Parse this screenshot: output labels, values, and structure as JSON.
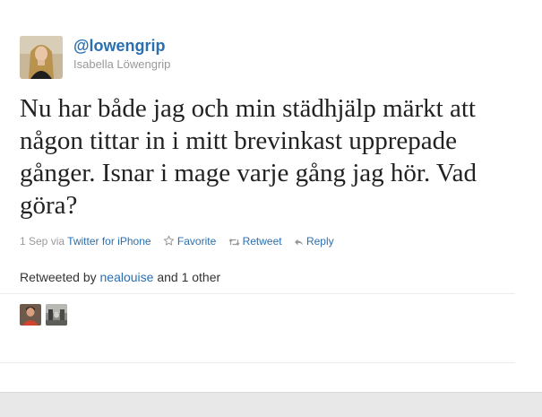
{
  "tweet": {
    "screen_name": "@lowengrip",
    "full_name": "Isabella Löwengrip",
    "text": "Nu har både jag och min städhjälp märkt att någon tittar in i mitt brevinkast upprepade gånger. Isnar i mage varje gång jag hör. Vad göra?",
    "date": "1 Sep",
    "via_label": "via",
    "source": "Twitter for iPhone",
    "actions": {
      "favorite": "Favorite",
      "retweet": "Retweet",
      "reply": "Reply"
    }
  },
  "retweeted": {
    "prefix": "Retweeted by",
    "user": "nealouise",
    "suffix": "and 1 other"
  },
  "icons": {
    "favorite": "star-outline-icon",
    "retweet": "retweet-icon",
    "reply": "reply-arrow-icon"
  },
  "colors": {
    "link": "#2a6fb0",
    "muted": "#999999",
    "text": "#222222"
  }
}
